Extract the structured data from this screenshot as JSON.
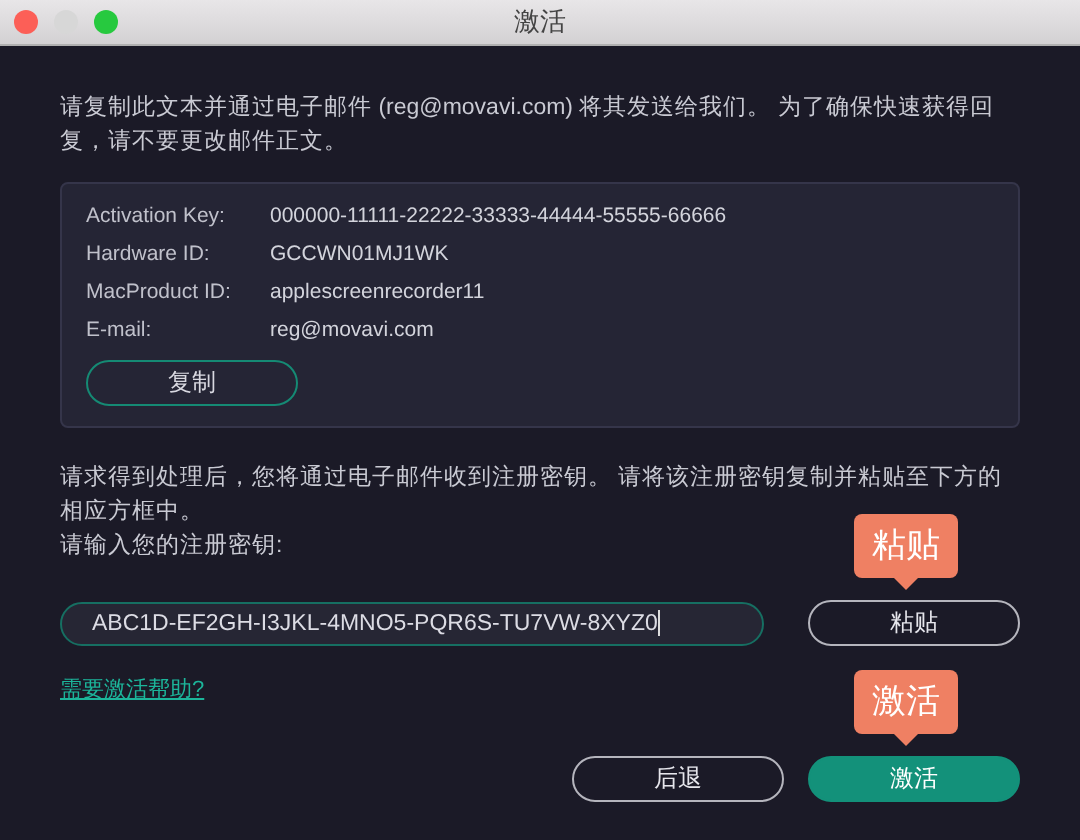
{
  "window": {
    "title": "激活"
  },
  "intro": "请复制此文本并通过电子邮件 (reg@movavi.com) 将其发送给我们。 为了确保快速获得回复，请不要更改邮件正文。",
  "info": [
    {
      "label": "Activation Key:",
      "value": "000000-11111-22222-33333-44444-55555-66666"
    },
    {
      "label": "Hardware ID:",
      "value": "GCCWN01MJ1WK"
    },
    {
      "label": "MacProduct ID:",
      "value": "applescreenrecorder11"
    },
    {
      "label": "E-mail:",
      "value": "reg@movavi.com"
    }
  ],
  "copy_button": "复制",
  "note": "请求得到处理后，您将通过电子邮件收到注册密钥。 请将该注册密钥复制并粘贴至下方的相应方框中。",
  "key_prompt": "请输入您的注册密钥:",
  "key_field": {
    "value": "ABC1D-EF2GH-I3JKL-4MNO5-PQR6S-TU7VW-8XYZ0"
  },
  "paste_button": {
    "label": "粘贴",
    "callout": "粘贴"
  },
  "help_link": "需要激活帮助?",
  "buttons": [
    {
      "label": "后退",
      "kind": "secondary"
    },
    {
      "label": "激活",
      "kind": "primary",
      "callout": "激活"
    }
  ]
}
